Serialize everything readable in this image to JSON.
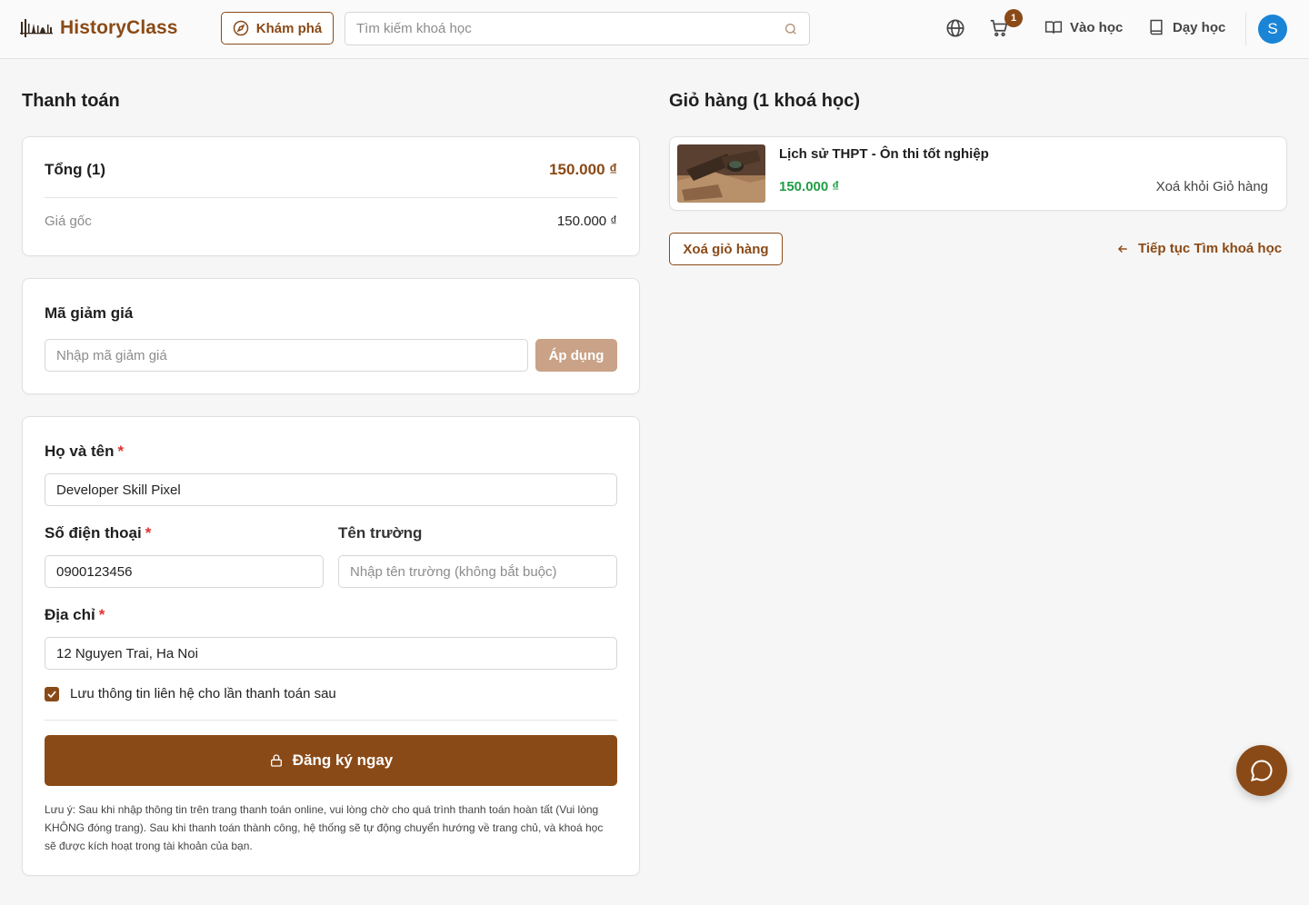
{
  "header": {
    "brand": "HistoryClass",
    "explore_label": "Khám phá",
    "search_placeholder": "Tìm kiếm khoá học",
    "cart_count": "1",
    "learn_label": "Vào học",
    "teach_label": "Dạy học",
    "avatar_initial": "S",
    "accent_color": "#8a4a17"
  },
  "checkout": {
    "title": "Thanh toán",
    "summary": {
      "total_label": "Tổng (1)",
      "total_value": "150.000 ₫",
      "original_label": "Giá gốc",
      "original_value": "150.000 ₫"
    },
    "coupon": {
      "title": "Mã giảm giá",
      "placeholder": "Nhập mã giảm giá",
      "apply_label": "Áp dụng"
    },
    "form": {
      "name_label": "Họ và tên",
      "name_value": "Developer Skill Pixel",
      "phone_label": "Số điện thoại",
      "phone_value": "0900123456",
      "school_label": "Tên trường",
      "school_placeholder": "Nhập tên trường (không bắt buộc)",
      "address_label": "Địa chỉ",
      "address_value": "12 Nguyen Trai, Ha Noi",
      "required_mark": "*",
      "save_info_label": "Lưu thông tin liên hệ cho lần thanh toán sau",
      "save_info_checked": true,
      "submit_label": "Đăng ký ngay",
      "note": "Lưu ý: Sau khi nhập thông tin trên trang thanh toán online, vui lòng chờ cho quá trình thanh toán hoàn tất (Vui lòng KHÔNG đóng trang). Sau khi thanh toán thành công, hệ thống sẽ tự động chuyển hướng về trang chủ, và khoá học sẽ được kích hoạt trong tài khoản của bạn."
    }
  },
  "cart": {
    "title": "Giỏ hàng (1 khoá học)",
    "items": [
      {
        "title": "Lịch sử THPT - Ôn thi tốt nghiệp",
        "price": "150.000 ₫",
        "remove_label": "Xoá khỏi Giỏ hàng"
      }
    ],
    "clear_label": "Xoá giỏ hàng",
    "continue_label": "Tiếp tục Tìm khoá học"
  }
}
